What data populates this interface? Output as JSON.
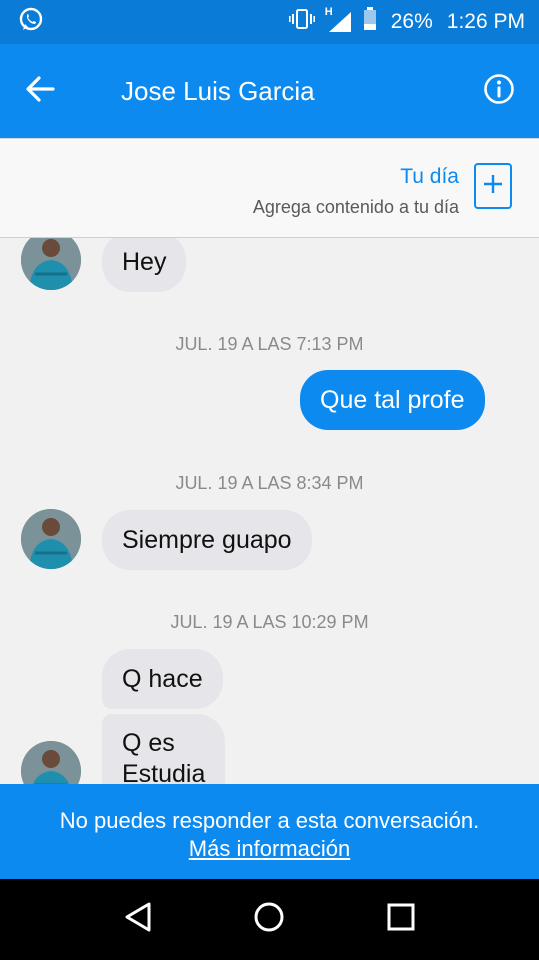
{
  "status_bar": {
    "battery": "26%",
    "time": "1:26 PM",
    "network": "H",
    "icons": [
      "whatsapp-icon",
      "vibrate-icon",
      "signal-icon",
      "battery-icon"
    ]
  },
  "header": {
    "title": "Jose Luis Garcia",
    "back_icon": "back-arrow-icon",
    "info_icon": "info-icon"
  },
  "story": {
    "title": "Tu día",
    "subtitle": "Agrega contenido a tu día",
    "add_icon": "plus-icon"
  },
  "messages": [
    {
      "type": "incoming",
      "text": "Hey"
    },
    {
      "type": "timestamp",
      "text": "JUL. 19 A LAS 7:13 PM"
    },
    {
      "type": "outgoing",
      "text": "Que tal profe"
    },
    {
      "type": "timestamp",
      "text": "JUL. 19 A LAS 8:34 PM"
    },
    {
      "type": "incoming",
      "text": "Siempre guapo"
    },
    {
      "type": "timestamp",
      "text": "JUL. 19 A LAS 10:29 PM"
    },
    {
      "type": "incoming",
      "text": "Q hace"
    },
    {
      "type": "incoming",
      "line1": "Q es",
      "line2": "Estudia"
    }
  ],
  "footer": {
    "message": "No puedes responder a esta conversación.",
    "link": "Más información"
  },
  "colors": {
    "status_bar": "#0a7bd6",
    "accent": "#0d8af0",
    "incoming_bubble": "#e5e5ea",
    "background": "#f1f1f2"
  }
}
